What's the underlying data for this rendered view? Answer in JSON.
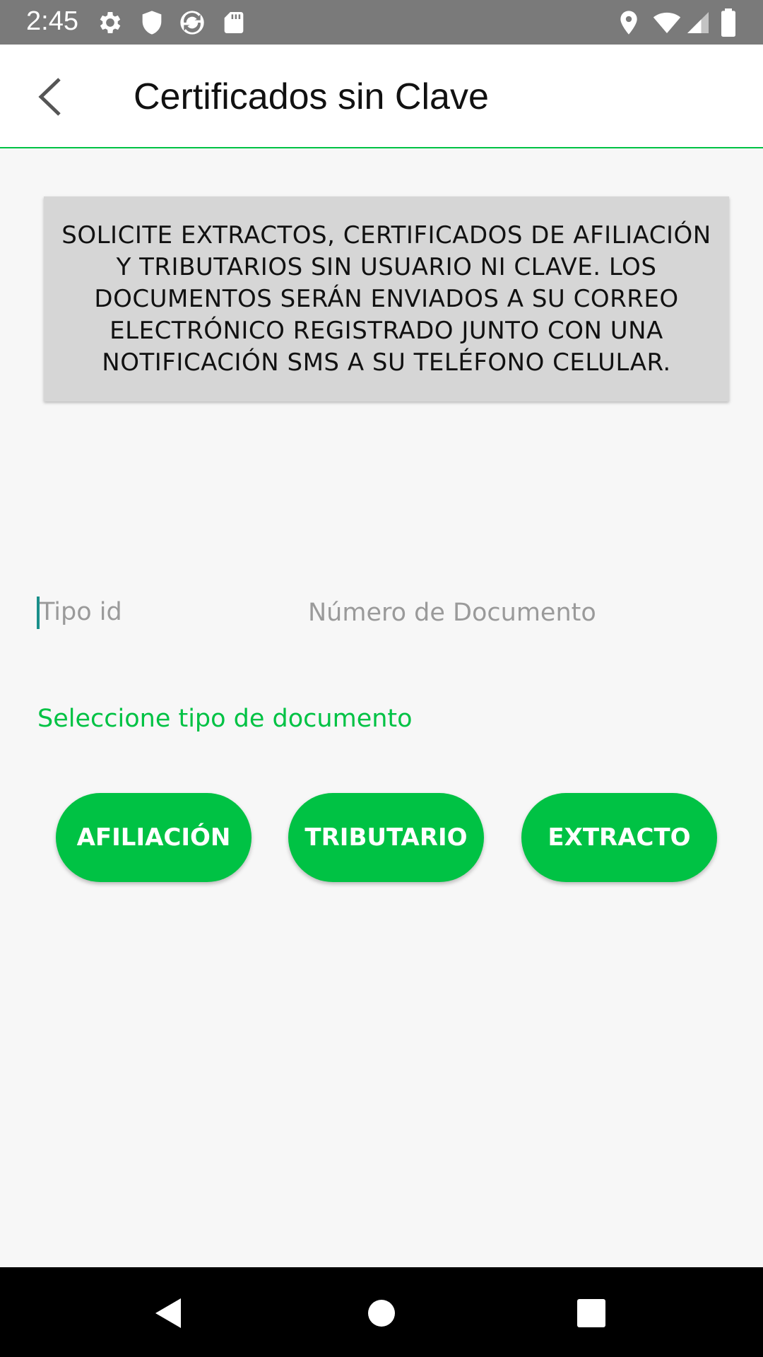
{
  "status_bar": {
    "time": "2:45",
    "left_icons": [
      "gear-icon",
      "shield-icon",
      "sync-icon",
      "sd-card-icon"
    ],
    "right_icons": [
      "location-icon",
      "wifi-icon",
      "signal-icon",
      "battery-icon"
    ]
  },
  "app_bar": {
    "title": "Certificados sin Clave",
    "back_icon": "back-arrow-icon"
  },
  "info": {
    "text": "SOLICITE EXTRACTOS, CERTIFICADOS DE AFILIACIÓN Y TRIBUTARIOS SIN USUARIO NI CLAVE. LOS DOCUMENTOS SERÁN ENVIADOS A SU CORREO ELECTRÓNICO REGISTRADO JUNTO CON UNA NOTIFICACIÓN SMS A SU TELÉFONO CELULAR."
  },
  "form": {
    "tipo_id_placeholder": "Tipo id",
    "numero_documento_placeholder": "Número de Documento"
  },
  "select_label": "Seleccione tipo de documento",
  "buttons": {
    "afiliacion": "AFILIACIÓN",
    "tributario": "TRIBUTARIO",
    "extracto": "EXTRACTO"
  },
  "colors": {
    "accent": "#00c244",
    "status_bar": "#7a7a7a",
    "info_box": "#d6d6d6"
  },
  "nav_bar": {
    "icons": [
      "nav-back-icon",
      "nav-home-icon",
      "nav-recents-icon"
    ]
  }
}
